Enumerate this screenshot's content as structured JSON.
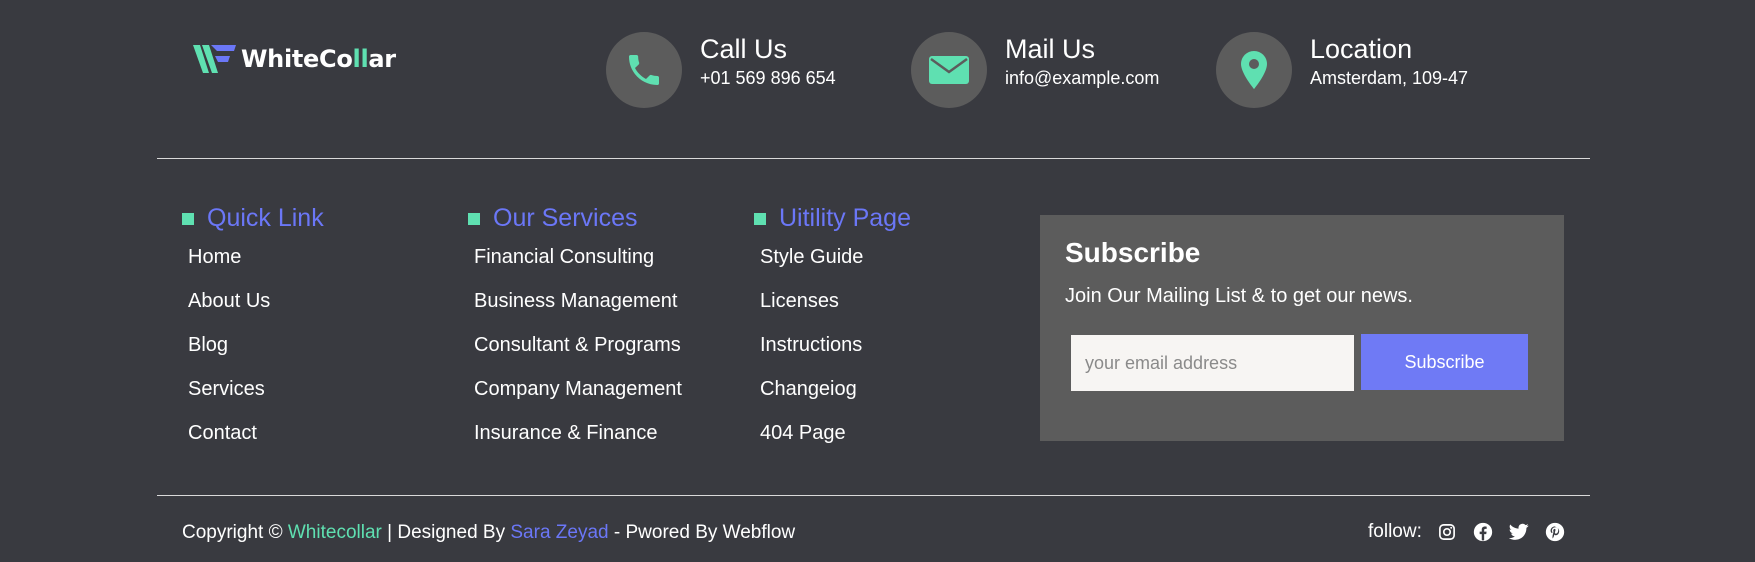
{
  "brand": {
    "name_part1": "WhiteCo",
    "name_part2": "ll",
    "name_part3": "ar"
  },
  "contacts": [
    {
      "title": "Call Us",
      "value": "+01 569 896 654",
      "icon": "phone-icon"
    },
    {
      "title": "Mail Us",
      "value": "info@example.com",
      "icon": "mail-icon"
    },
    {
      "title": "Location",
      "value": "Amsterdam, 109-47",
      "icon": "location-icon"
    }
  ],
  "columns": [
    {
      "heading": "Quick Link",
      "links": [
        "Home",
        "About Us",
        "Blog",
        "Services",
        "Contact"
      ]
    },
    {
      "heading": "Our Services",
      "links": [
        "Financial Consulting",
        "Business Management",
        "Consultant & Programs",
        "Company Management",
        "Insurance & Finance"
      ]
    },
    {
      "heading": "Uitility Page",
      "links": [
        "Style Guide",
        "Licenses",
        "Instructions",
        "Changeiog",
        "404 Page"
      ]
    }
  ],
  "subscribe": {
    "title": "Subscribe",
    "description": "Join Our Mailing List & to get our news.",
    "placeholder": "your email address",
    "button_label": "Subscribe"
  },
  "footer": {
    "copyright_prefix": "Copyright © ",
    "brand_link": "Whitecollar",
    "designed_by_text": " | Designed By ",
    "designer_link": "Sara Zeyad",
    "powered_text": " - Pwored By Webflow",
    "follow_label": "follow:",
    "social_icons": [
      "instagram-icon",
      "facebook-icon",
      "twitter-icon",
      "pinterest-icon"
    ]
  },
  "colors": {
    "background": "#393a40",
    "accent_green": "#5fe0b1",
    "accent_blue": "#6b77f7",
    "panel": "#5c5c5c"
  }
}
